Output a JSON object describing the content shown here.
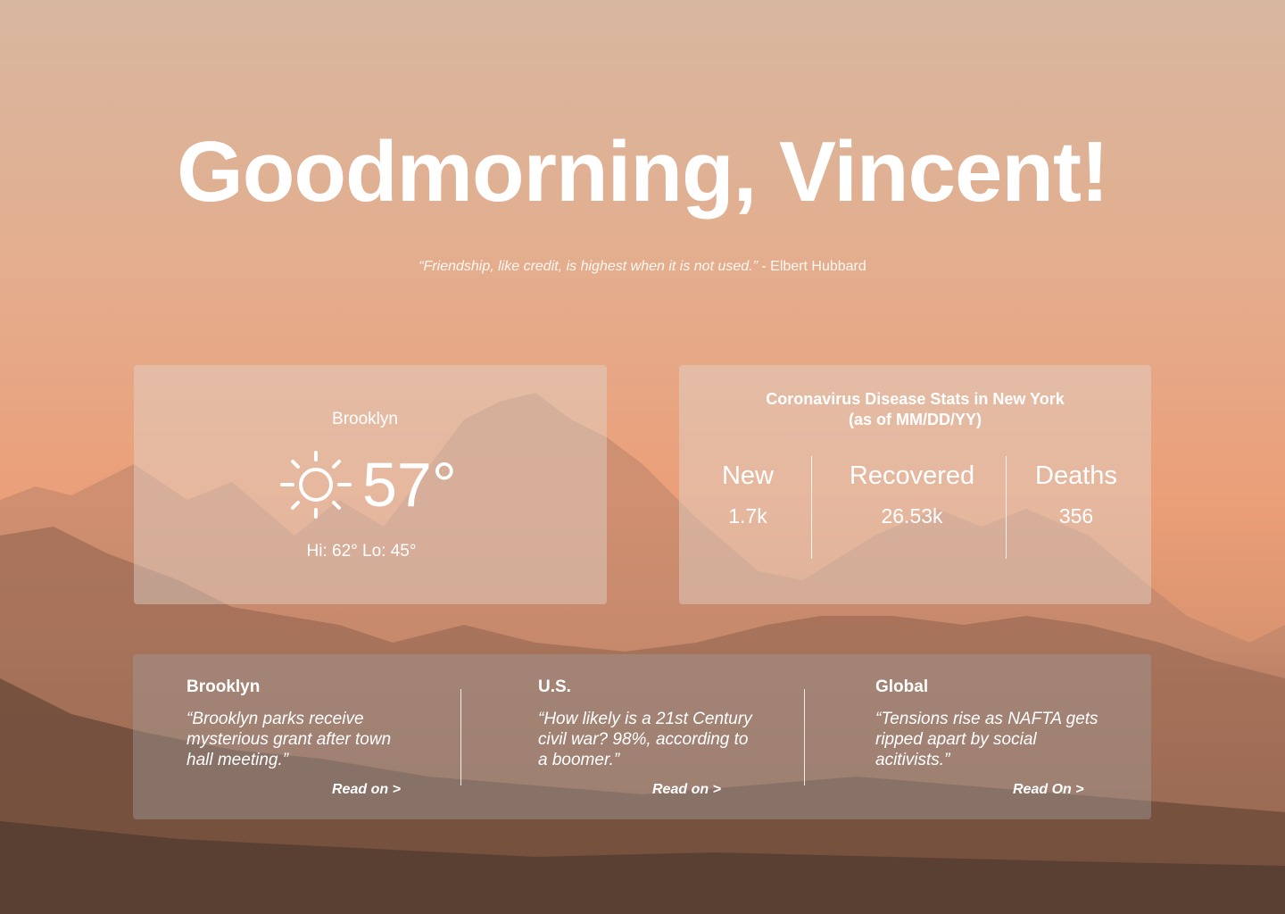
{
  "greeting": "Goodmorning, Vincent!",
  "quote": {
    "text": "“Friendship, like credit, is highest when it is not used.”",
    "author": " - Elbert Hubbard"
  },
  "weather": {
    "location": "Brooklyn",
    "icon": "sun-icon",
    "temperature": "57°",
    "hi_lo": "Hi: 62° Lo: 45°"
  },
  "covid": {
    "title_line1": "Coronavirus Disease Stats in New York",
    "title_line2": "(as of MM/DD/YY)",
    "stats": [
      {
        "label": "New",
        "value": "1.7k"
      },
      {
        "label": "Recovered",
        "value": "26.53k"
      },
      {
        "label": "Deaths",
        "value": "356"
      }
    ]
  },
  "news": [
    {
      "region": "Brooklyn",
      "headline": "“Brooklyn parks receive mysterious grant after town hall meeting.”",
      "link": "Read on >"
    },
    {
      "region": "U.S.",
      "headline": "“How likely is a 21st Century civil war? 98%, according to a boomer.”",
      "link": "Read on >"
    },
    {
      "region": "Global",
      "headline": "“Tensions rise as NAFTA gets ripped apart by social acitivists.”",
      "link": "Read On >"
    }
  ],
  "colors": {
    "sky_top": "#d8b7a0",
    "sky_mid": "#eb9f78",
    "mountain_dark": "#5a4032",
    "text": "#ffffff"
  }
}
